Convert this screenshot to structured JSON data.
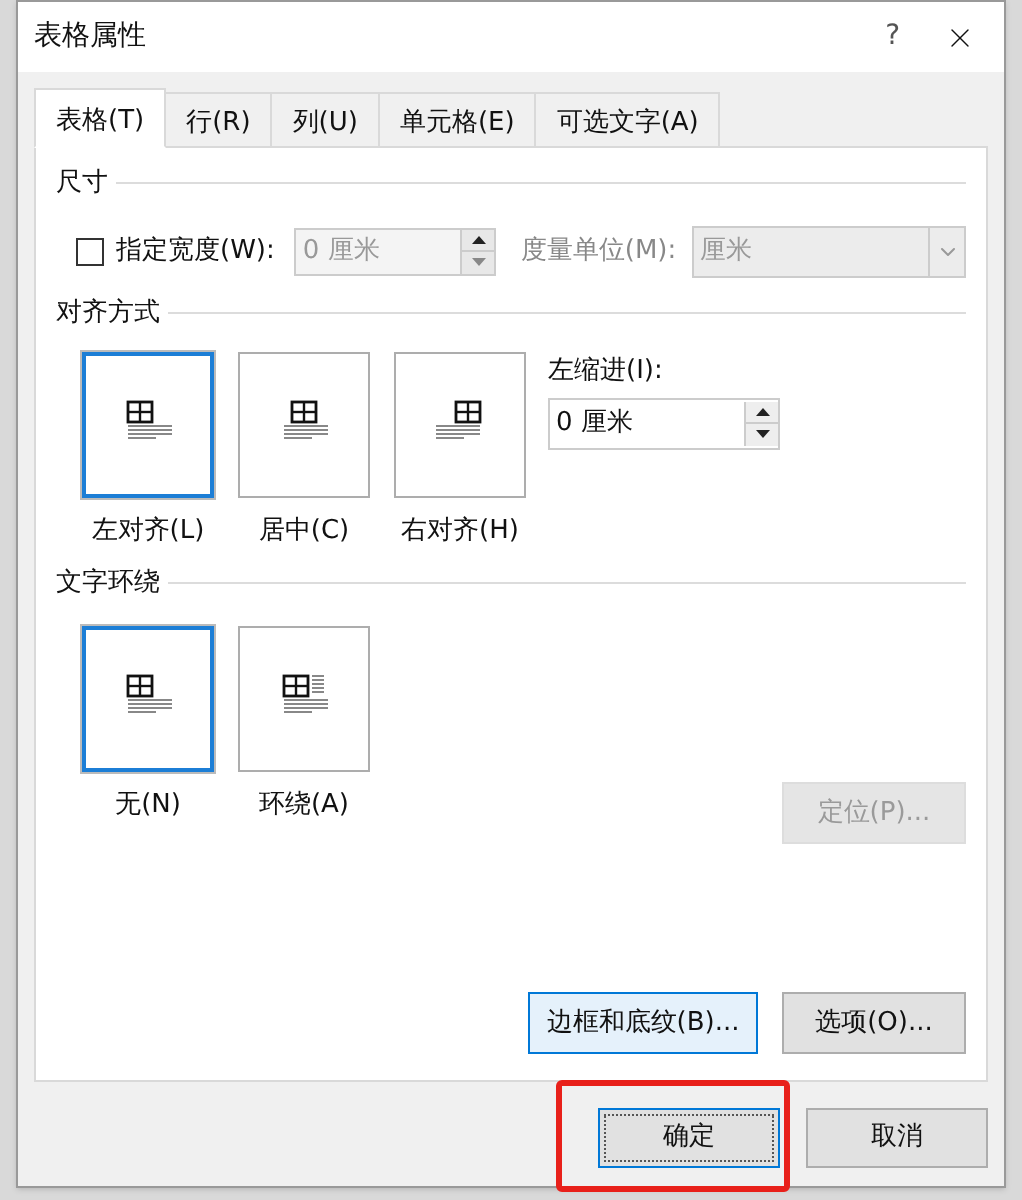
{
  "window": {
    "title": "表格属性",
    "help": "?"
  },
  "tabs": [
    {
      "label": "表格(T)",
      "selected": true
    },
    {
      "label": "行(R)",
      "selected": false
    },
    {
      "label": "列(U)",
      "selected": false
    },
    {
      "label": "单元格(E)",
      "selected": false
    },
    {
      "label": "可选文字(A)",
      "selected": false
    }
  ],
  "size": {
    "title": "尺寸",
    "checkbox": {
      "label": "指定宽度(W):",
      "checked": false
    },
    "width_field": {
      "value": "0 厘米",
      "disabled": true
    },
    "unit": {
      "label": "度量单位(M):",
      "value": "厘米",
      "disabled": true
    }
  },
  "alignment": {
    "title": "对齐方式",
    "options": [
      {
        "label": "左对齐(L)",
        "kind": "left",
        "selected": true
      },
      {
        "label": "居中(C)",
        "kind": "center",
        "selected": false
      },
      {
        "label": "右对齐(H)",
        "kind": "right",
        "selected": false
      }
    ],
    "indent": {
      "label": "左缩进(I):",
      "value": "0 厘米"
    }
  },
  "wrapping": {
    "title": "文字环绕",
    "options": [
      {
        "label": "无(N)",
        "kind": "none",
        "selected": true
      },
      {
        "label": "环绕(A)",
        "kind": "around",
        "selected": false
      }
    ],
    "position_button": {
      "label": "定位(P)...",
      "disabled": true
    }
  },
  "panel_buttons": [
    {
      "label": "边框和底纹(B)...",
      "focused": true
    },
    {
      "label": "选项(O)...",
      "focused": false
    }
  ],
  "footer": [
    {
      "label": "确定",
      "highlighted": true
    },
    {
      "label": "取消",
      "highlighted": false
    }
  ]
}
